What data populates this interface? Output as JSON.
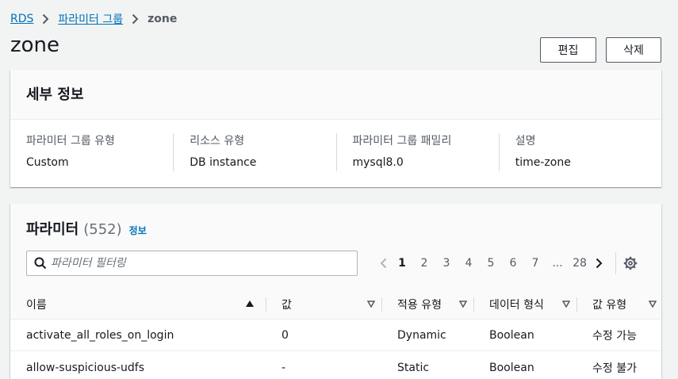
{
  "breadcrumb": {
    "items": [
      "RDS",
      "파라미터 그룹"
    ],
    "current": "zone"
  },
  "page": {
    "title": "zone",
    "edit_label": "편집",
    "delete_label": "삭제"
  },
  "details": {
    "heading": "세부 정보",
    "fields": [
      {
        "label": "파라미터 그룹 유형",
        "value": "Custom"
      },
      {
        "label": "리소스 유형",
        "value": "DB instance"
      },
      {
        "label": "파라미터 그룹 패밀리",
        "value": "mysql8.0"
      },
      {
        "label": "설명",
        "value": "time-zone"
      }
    ]
  },
  "parameters": {
    "heading": "파라미터",
    "count": "(552)",
    "info_link": "정보",
    "filter_placeholder": "파라미터 필터링",
    "pagination": {
      "pages": [
        "1",
        "2",
        "3",
        "4",
        "5",
        "6",
        "7"
      ],
      "current": "1",
      "ellipsis": "...",
      "last": "28"
    },
    "columns": [
      "이름",
      "값",
      "적용 유형",
      "데이터 형식",
      "값 유형"
    ],
    "rows": [
      {
        "name": "activate_all_roles_on_login",
        "value": "0",
        "apply_type": "Dynamic",
        "data_type": "Boolean",
        "modifiable": "수정 가능"
      },
      {
        "name": "allow-suspicious-udfs",
        "value": "-",
        "apply_type": "Static",
        "data_type": "Boolean",
        "modifiable": "수정 불가"
      }
    ]
  },
  "colors": {
    "link": "#0073bb",
    "text": "#16191f",
    "muted": "#545b64",
    "background": "#f2f3f3"
  },
  "icons": [
    "chevron-right-icon",
    "search-icon",
    "chevron-left-icon",
    "settings-gear-icon",
    "sort-ascending-icon",
    "sort-descending-icon"
  ]
}
